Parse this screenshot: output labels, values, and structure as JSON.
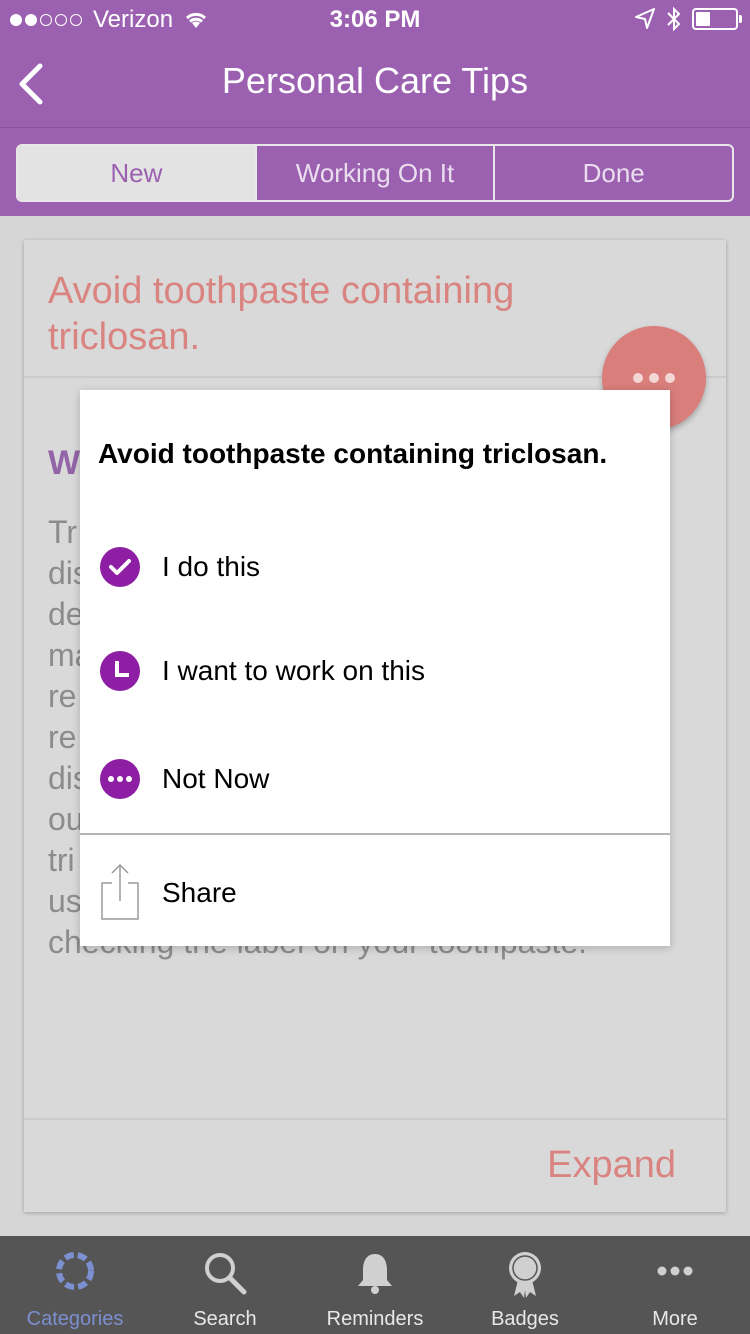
{
  "status_bar": {
    "carrier": "Verizon",
    "time": "3:06 PM",
    "signal_bars": 2,
    "signal_total": 5
  },
  "nav": {
    "title": "Personal Care Tips",
    "back_icon": "chevron-left-icon"
  },
  "segments": [
    {
      "label": "New",
      "active": true
    },
    {
      "label": "Working On It",
      "active": false
    },
    {
      "label": "Done",
      "active": false
    }
  ],
  "card": {
    "title": "Avoid toothpaste containing triclosan.",
    "subheading": "W",
    "body": "Tr\ndis\nde                                                  d\nma                                              c-\nre\nre\ndis\nou\ntri\nus\nchecking the label on your toothpaste.",
    "expand_label": "Expand"
  },
  "popup": {
    "title": "Avoid toothpaste containing triclosan.",
    "options": [
      {
        "label": "I do this",
        "icon": "check-icon"
      },
      {
        "label": "I want to work on this",
        "icon": "clock-icon"
      },
      {
        "label": "Not Now",
        "icon": "ellipsis-icon"
      }
    ],
    "share_label": "Share"
  },
  "tabbar": {
    "items": [
      {
        "label": "Categories",
        "icon": "categories-icon",
        "active": true
      },
      {
        "label": "Search",
        "icon": "search-icon",
        "active": false
      },
      {
        "label": "Reminders",
        "icon": "bell-icon",
        "active": false
      },
      {
        "label": "Badges",
        "icon": "badge-icon",
        "active": false
      },
      {
        "label": "More",
        "icon": "more-icon",
        "active": false
      }
    ]
  },
  "colors": {
    "brand_purple": "#9b61b0",
    "accent_coral": "#d98480",
    "popup_icon_purple": "#8e1ea3",
    "tab_active": "#7c8fd0"
  }
}
